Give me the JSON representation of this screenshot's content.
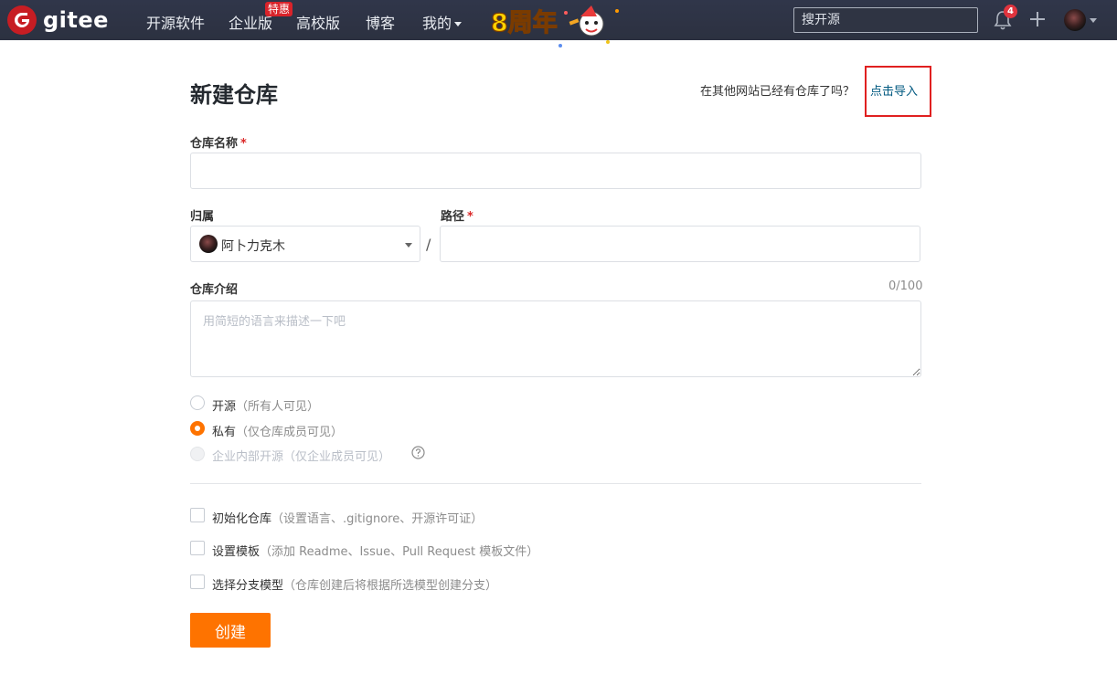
{
  "header": {
    "logo_text": "gitee",
    "nav": [
      "开源软件",
      "企业版",
      "高校版",
      "博客",
      "我的"
    ],
    "hot_badge": "特惠",
    "anniversary_text": "8周年",
    "search_placeholder": "搜开源",
    "notification_count": "4",
    "icons": [
      "gitee-logo-icon",
      "bell-icon",
      "plus-icon",
      "avatar",
      "chevron-down-icon"
    ],
    "colors": {
      "background": "#2f3443",
      "badge": "#d9232a"
    }
  },
  "main": {
    "title": "新建仓库",
    "import_hint": "在其他网站已经有仓库了吗？",
    "import_link": "点击导入",
    "repo_name_label": "仓库名称",
    "required_mark": "*",
    "owner_label": "归属",
    "owner_value": "阿卜力克木",
    "path_separator": "/",
    "path_label": "路径",
    "desc_label": "仓库介绍",
    "desc_counter": "0/100",
    "desc_placeholder": "用简短的语言来描述一下吧",
    "visibility": [
      {
        "label": "开源",
        "note": "（所有人可见）",
        "selected": false,
        "disabled": false
      },
      {
        "label": "私有",
        "note": "（仅仓库成员可见）",
        "selected": true,
        "disabled": false
      },
      {
        "label": "企业内部开源",
        "note": "（仅企业成员可见）",
        "selected": false,
        "disabled": true
      }
    ],
    "options": [
      {
        "label": "初始化仓库",
        "note": "（设置语言、.gitignore、开源许可证）",
        "checked": false
      },
      {
        "label": "设置模板",
        "note": "（添加 Readme、Issue、Pull Request 模板文件）",
        "checked": false
      },
      {
        "label": "选择分支模型",
        "note": "（仓库创建后将根据所选模型创建分支）",
        "checked": false
      }
    ],
    "create_button": "创建",
    "colors": {
      "accent": "#fe7300",
      "link": "#005980",
      "required": "#db2828",
      "highlight": "#e02020"
    }
  }
}
